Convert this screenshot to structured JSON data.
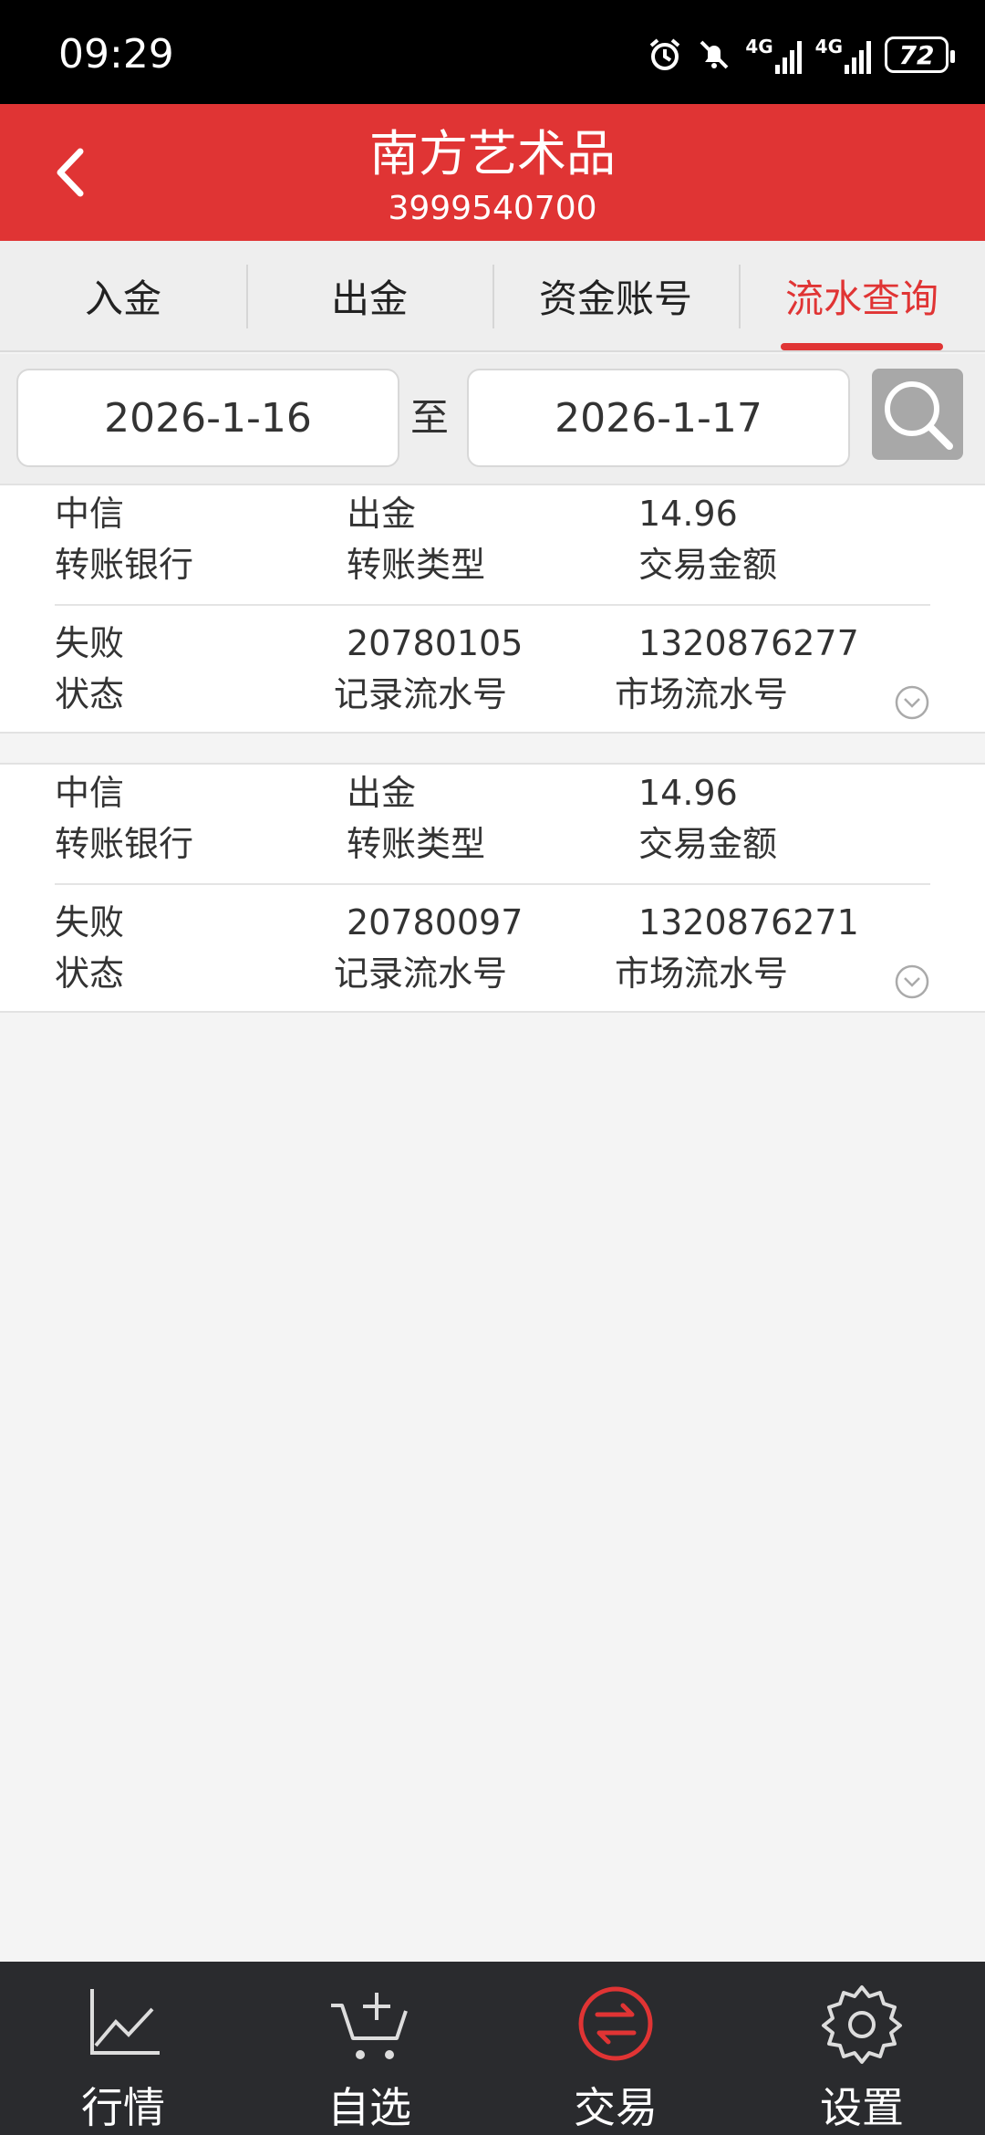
{
  "status": {
    "time": "09:29",
    "battery": "72",
    "network1": "4G",
    "network2": "4G"
  },
  "header": {
    "title": "南方艺术品",
    "subtitle": "3999540700"
  },
  "tabs": [
    {
      "label": "入金"
    },
    {
      "label": "出金"
    },
    {
      "label": "资金账号"
    },
    {
      "label": "流水查询"
    }
  ],
  "filter": {
    "start_date": "2026-1-16",
    "to_label": "至",
    "end_date": "2026-1-17"
  },
  "records": [
    {
      "bank": "中信",
      "bank_label": "转账银行",
      "type": "出金",
      "type_label": "转账类型",
      "amount": "14.96",
      "amount_label": "交易金额",
      "status": "失败",
      "status_label": "状态",
      "record_no": "20780105",
      "record_no_label": "记录流水号",
      "market_no": "1320876277",
      "market_no_label": "市场流水号"
    },
    {
      "bank": "中信",
      "bank_label": "转账银行",
      "type": "出金",
      "type_label": "转账类型",
      "amount": "14.96",
      "amount_label": "交易金额",
      "status": "失败",
      "status_label": "状态",
      "record_no": "20780097",
      "record_no_label": "记录流水号",
      "market_no": "1320876271",
      "market_no_label": "市场流水号"
    }
  ],
  "nav": [
    {
      "label": "行情",
      "icon": "chart-icon"
    },
    {
      "label": "自选",
      "icon": "cart-add-icon"
    },
    {
      "label": "交易",
      "icon": "exchange-icon"
    },
    {
      "label": "设置",
      "icon": "gear-icon"
    }
  ],
  "colors": {
    "accent": "#e03434",
    "nav_bg": "#2a2b2e",
    "active_icon": "#e03434"
  }
}
